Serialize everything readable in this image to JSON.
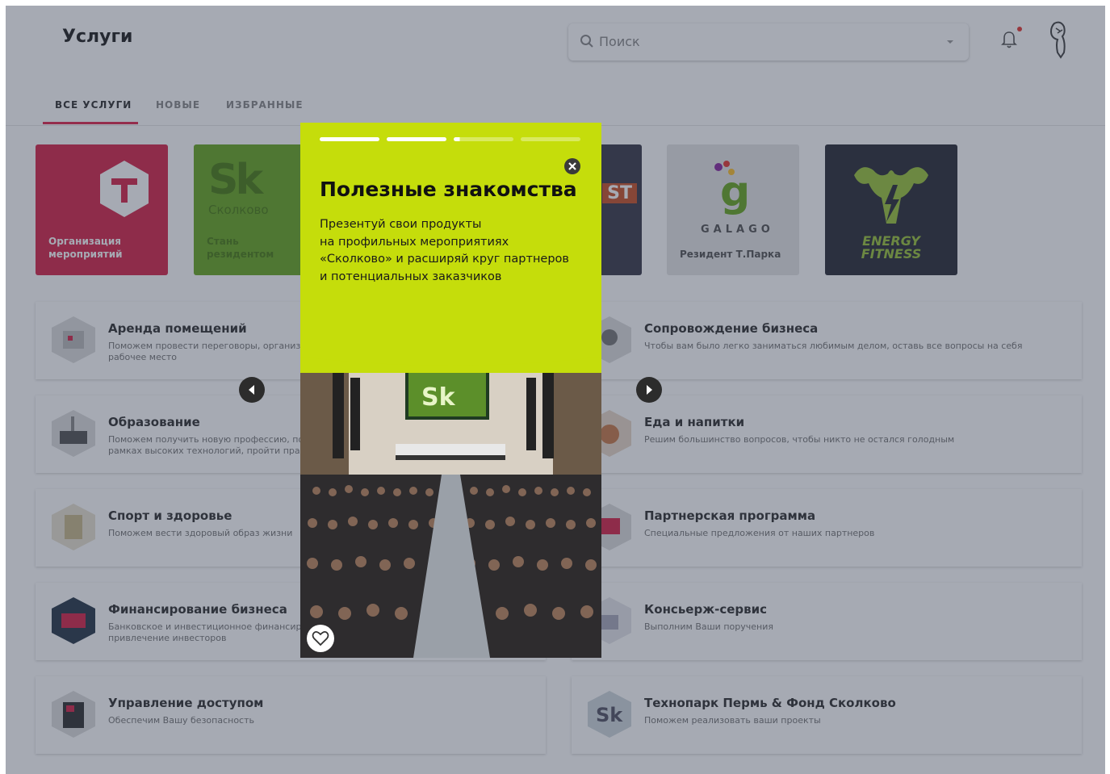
{
  "header": {
    "title": "Услуги",
    "search_placeholder": "Поиск"
  },
  "tabs": [
    {
      "label": "ВСЕ УСЛУГИ"
    },
    {
      "label": "НОВЫЕ"
    },
    {
      "label": "ИЗБРАННЫЕ"
    }
  ],
  "tiles": [
    {
      "label_lines": [
        "Организация",
        "мероприятий"
      ],
      "color": "#d6264a"
    },
    {
      "label_lines": [
        "Стань",
        "резидентом"
      ],
      "logo": "Sk",
      "logo_sub": "Сколково",
      "color": "#6aa823"
    },
    {
      "logo": "ST",
      "color": "#3c3c4a"
    },
    {
      "label_lines": [
        "Резидент Т.Парка"
      ],
      "logo": "GALAGO",
      "color": "#e6e6e6"
    },
    {
      "logo_lines": [
        "ENERGY",
        "FITNESS"
      ],
      "color": "#2b2d38"
    }
  ],
  "services_left": [
    {
      "name": "Аренда помещений",
      "desc": [
        "Поможем провести переговоры, организовать",
        "рабочее место"
      ]
    },
    {
      "name": "Образование",
      "desc": [
        "Поможем получить новую профессию, повысить квалификацию в",
        "рамках высоких технологий, пройти практику"
      ]
    },
    {
      "name": "Спорт и здоровье",
      "desc": [
        "Поможем вести здоровый образ жизни"
      ]
    },
    {
      "name": "Финансирование бизнеса",
      "desc": [
        "Банковское и инвестиционное финансирование,",
        "привлечение инвесторов"
      ]
    },
    {
      "name": "Управление доступом",
      "desc": [
        "Обеспечим Вашу безопасность"
      ]
    }
  ],
  "services_right": [
    {
      "name": "Сопровождение бизнеса",
      "desc": [
        "Чтобы вам было легко заниматься любимым делом, оставь все вопросы на себя"
      ]
    },
    {
      "name": "Еда и напитки",
      "desc": [
        "Решим большинство вопросов, чтобы никто не остался голодным"
      ]
    },
    {
      "name": "Партнерская программа",
      "desc": [
        "Специальные предложения от наших партнеров"
      ]
    },
    {
      "name": "Консьерж-сервис",
      "desc": [
        "Выполним Ваши поручения"
      ]
    },
    {
      "name": "Технопарк Пермь & Фонд Сколково",
      "desc": [
        "Поможем реализовать ваши проекты"
      ]
    }
  ],
  "story": {
    "title": "Полезные знакомства",
    "text_lines": [
      "Презентуй свои продукты",
      "на профильных мероприятиях",
      "«Сколково» и расширяй круг партнеров",
      "и потенциальных заказчиков"
    ],
    "progress": [
      1,
      1,
      0.1,
      0
    ],
    "screen_logo": "Sk",
    "accent_color": "#c5dd0b"
  }
}
